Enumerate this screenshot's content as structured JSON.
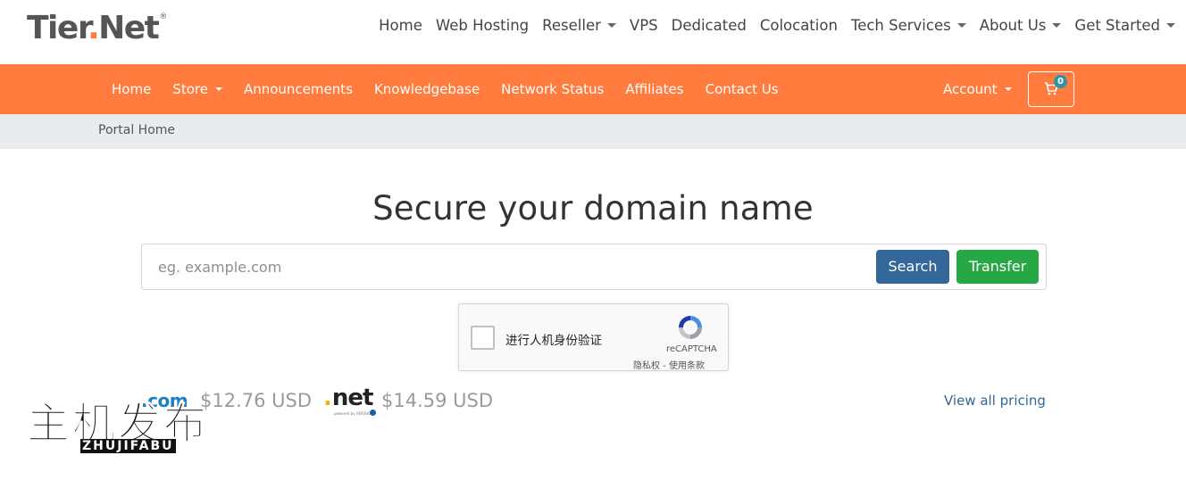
{
  "brand": {
    "logo_main": "Tier",
    "logo_dot": ".",
    "logo_tail": "Net",
    "logo_reg": "®"
  },
  "top_nav": [
    {
      "label": "Home",
      "dropdown": false
    },
    {
      "label": "Web Hosting",
      "dropdown": false
    },
    {
      "label": "Reseller",
      "dropdown": true
    },
    {
      "label": "VPS",
      "dropdown": false
    },
    {
      "label": "Dedicated",
      "dropdown": false
    },
    {
      "label": "Colocation",
      "dropdown": false
    },
    {
      "label": "Tech Services",
      "dropdown": true
    },
    {
      "label": "About Us",
      "dropdown": true
    },
    {
      "label": "Get Started",
      "dropdown": true
    }
  ],
  "main_nav": [
    {
      "label": "Home",
      "dropdown": false
    },
    {
      "label": "Store",
      "dropdown": true
    },
    {
      "label": "Announcements",
      "dropdown": false
    },
    {
      "label": "Knowledgebase",
      "dropdown": false
    },
    {
      "label": "Network Status",
      "dropdown": false
    },
    {
      "label": "Affiliates",
      "dropdown": false
    },
    {
      "label": "Contact Us",
      "dropdown": false
    }
  ],
  "account": {
    "label": "Account",
    "cart_count": "0"
  },
  "breadcrumb": {
    "label": "Portal Home"
  },
  "hero": {
    "title": "Secure your domain name",
    "search_placeholder": "eg. example.com",
    "search_label": "Search",
    "transfer_label": "Transfer"
  },
  "captcha": {
    "label": "进行人机身份验证",
    "brand": "reCAPTCHA",
    "links": "隐私权 - 使用条款"
  },
  "pricing": {
    "com_tld": ".com",
    "com_price": "$12.76 USD",
    "net_tld_dot": ".",
    "net_tld_word": "net",
    "net_powered": "powered by VERISIGN",
    "net_price": "$14.59 USD",
    "view_all": "View all pricing"
  },
  "watermark": {
    "cn": "主机发布",
    "en": "ZHUJIFABU"
  },
  "colors": {
    "accent_orange": "#ff7b3e",
    "search_blue": "#336699",
    "transfer_green": "#28a745",
    "breadcrumb_bg": "#e9ecef"
  }
}
